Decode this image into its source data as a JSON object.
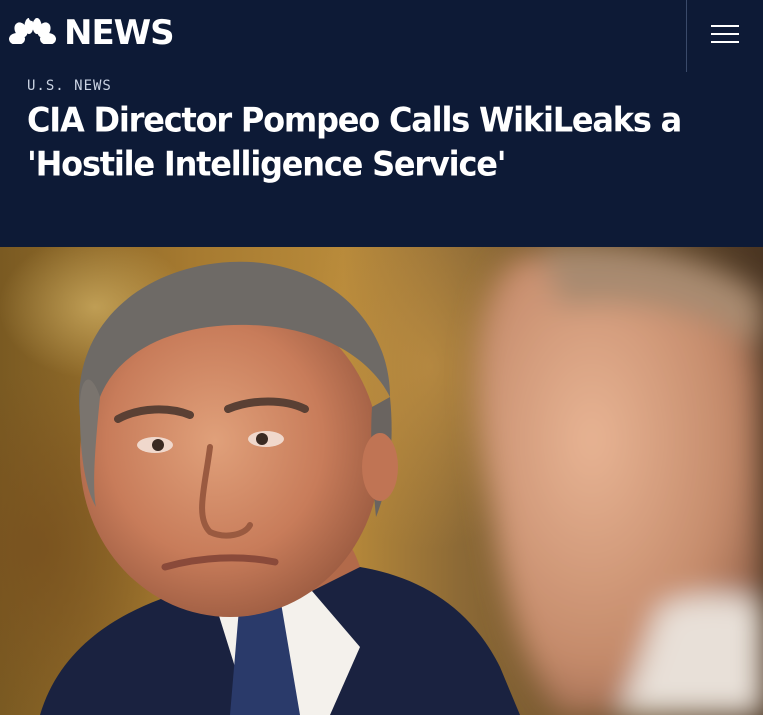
{
  "header": {
    "brand": "NEWS",
    "menu_icon": "hamburger-menu-icon",
    "logo_icon": "peacock-icon",
    "background_color": "#0d1a36"
  },
  "article": {
    "section": "U.S. NEWS",
    "title": "CIA Director Pompeo Calls WikiLeaks a 'Hostile Intelligence Service'"
  },
  "hero_image": {
    "description_icon": "photo"
  }
}
